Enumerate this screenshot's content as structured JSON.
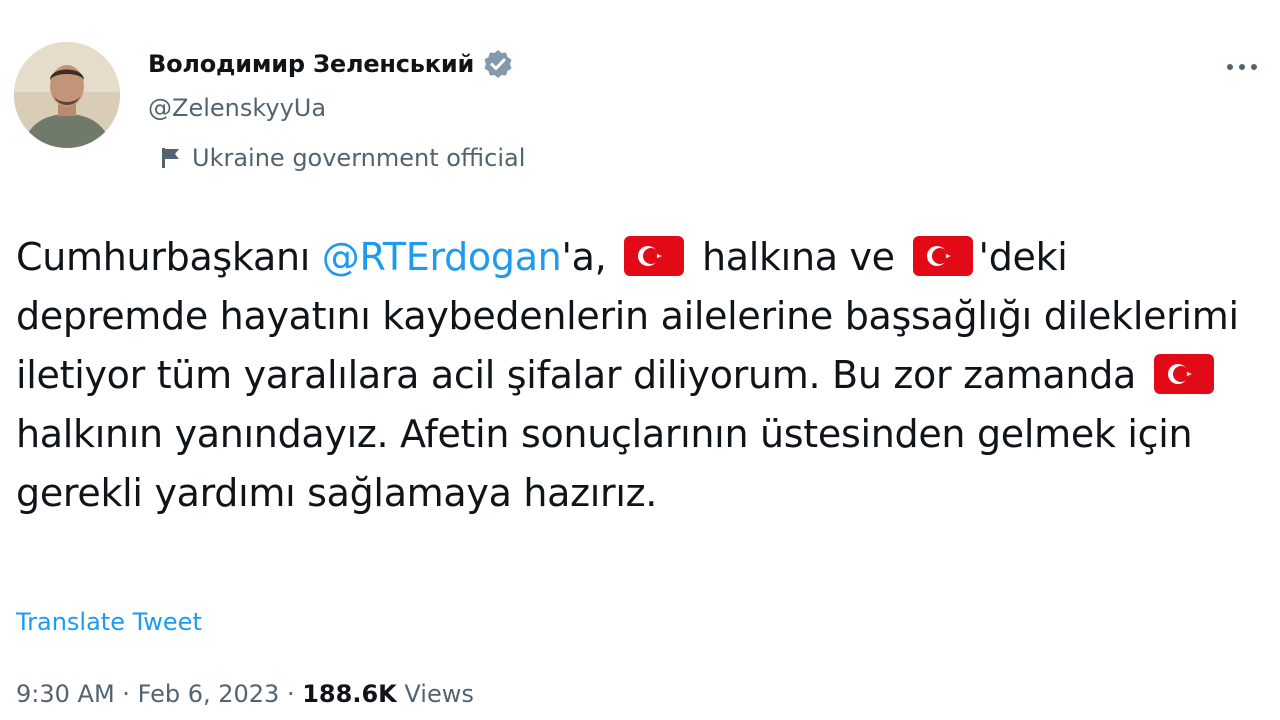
{
  "author": {
    "display_name": "Володимир Зеленський",
    "handle": "@ZelenskyyUa",
    "label": "Ukraine government official",
    "verified": true,
    "verified_color": "#1d9bf0"
  },
  "tweet": {
    "part1": "Cumhurbaşkanı ",
    "mention": "@RTErdogan",
    "part2": "'a, ",
    "part3": " halkına ve ",
    "part4": "'deki depremde hayatını kaybedenlerin ailelerine başsağlığı dileklerimi iletiyor tüm yaralılara acil şifalar diliyorum. Bu zor zamanda ",
    "part5": " halkının yanındayız. Afetin sonuçlarının üstesinden gelmek için gerekli yardımı sağlamaya hazırız.",
    "flag_emoji": "turkey-flag-icon",
    "flag_color": "#e30a17"
  },
  "translate_label": "Translate Tweet",
  "meta": {
    "time": "9:30 AM",
    "separator": "·",
    "date": "Feb 6, 2023",
    "views_count": "188.6K",
    "views_label": "Views"
  },
  "icons": {
    "more": "more-options-icon",
    "label": "flag-icon",
    "verified": "verified-badge-icon"
  },
  "colors": {
    "link": "#1d9bf0",
    "secondary_text": "#536471",
    "primary_text": "#0f1419"
  }
}
